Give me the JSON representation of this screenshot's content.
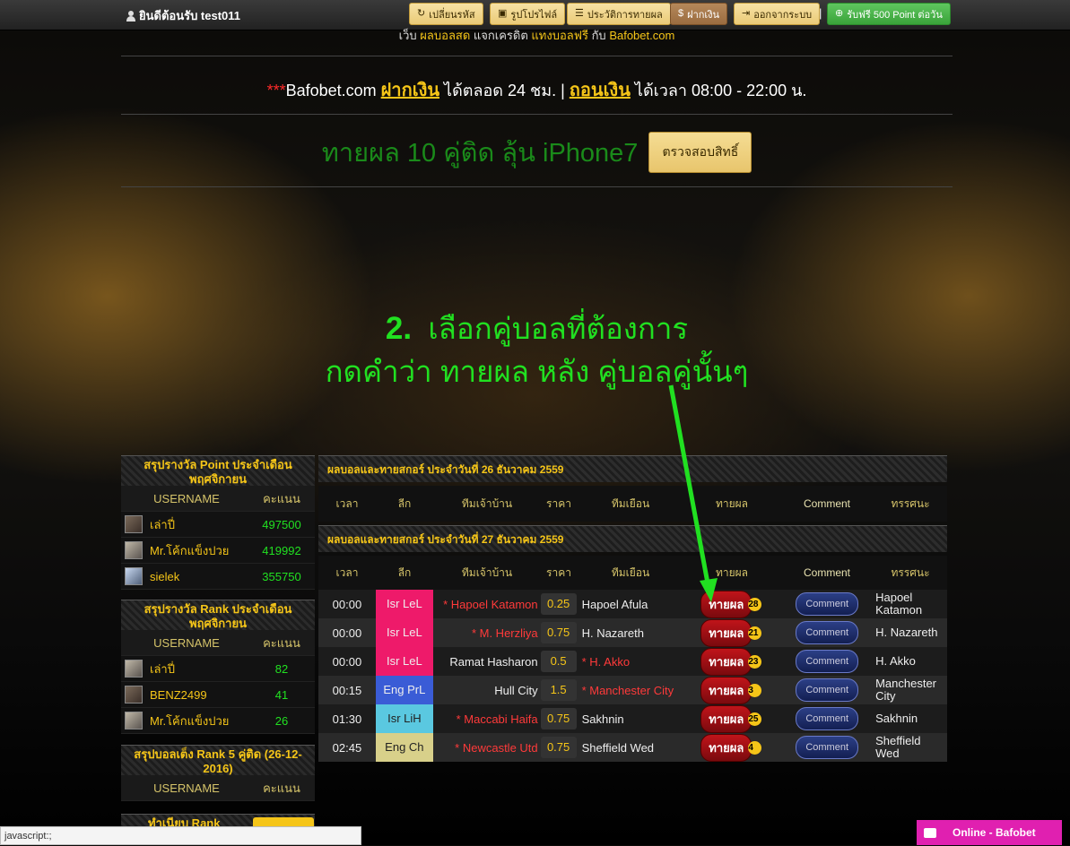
{
  "topbar": {
    "welcome": "ยินดีต้อนรับ test011",
    "buttons": {
      "change_password": "เปลี่ยนรหัส",
      "profile_picture": "รูปโปรไฟล์",
      "guess_history": "ประวัติการทายผล",
      "deposit": "ฝากเงิน",
      "logout": "ออกจากระบบ",
      "free_points": "รับฟรี 500 Point ต่อวัน"
    },
    "separator": "|"
  },
  "banner": {
    "cut_text_1": "เว็บ",
    "cut_link_1": "ผลบอลสด",
    "cut_text_2": "แจกเครดิต",
    "cut_link_2": "แทงบอลฟรี",
    "cut_text_3": "กับ",
    "cut_link_3": "Bafobet.com",
    "stars": "***",
    "site": "Bafobet.com",
    "deposit_link": "ฝากเงิน",
    "deposit_text": "ได้ตลอด 24 ชม. |",
    "withdraw_link": "ถอนเงิน",
    "withdraw_text": "ได้เวลา 08:00 - 22:00 น.",
    "promo_text": "ทายผล 10 คู่ติด ลุ้น iPhone7",
    "promo_button": "ตรวจสอบสิทธิ์"
  },
  "instruction": {
    "step": "2.",
    "line1": "เลือกคู่บอลที่ต้องการ",
    "line2": "กดคำว่า ทายผล หลัง คู่บอลคู่นั้นๆ"
  },
  "sidebar": {
    "point_title": "สรุปรางวัล Point ประจำเดือน พฤศจิกายน",
    "rank_title": "สรุปรางวัล Rank ประจำเดือน พฤศจิกายน",
    "rank5_title": "สรุปบอลเต็ง Rank 5 คู่ติด (26-12-2016)",
    "last_title": "ทำเนียบ Rank",
    "col_user": "USERNAME",
    "col_score": "คะแนน",
    "point_rows": [
      {
        "user": "เล่าปี่",
        "score": "497500"
      },
      {
        "user": "Mr.โค้กแข็งปวย",
        "score": "419992"
      },
      {
        "user": "sielek",
        "score": "355750"
      }
    ],
    "rank_rows": [
      {
        "user": "เล่าปี่",
        "score": "82"
      },
      {
        "user": "BENZ2499",
        "score": "41"
      },
      {
        "user": "Mr.โค้กแข็งปวย",
        "score": "26"
      }
    ]
  },
  "main": {
    "section1_title": "ผลบอลและทายสกอร์ ประจำวันที่ 26 ธันวาคม 2559",
    "section2_title": "ผลบอลและทายสกอร์ ประจำวันที่ 27 ธันวาคม 2559",
    "columns": {
      "time": "เวลา",
      "league": "ลีก",
      "home": "ทีมเจ้าบ้าน",
      "price": "ราคา",
      "away": "ทีมเยือน",
      "guess": "ทายผล",
      "comment": "Comment",
      "view": "ทรรศนะ"
    },
    "guess_label": "ทายผล",
    "comment_label": "Comment",
    "matches": [
      {
        "time": "00:00",
        "league": "Isr LeL",
        "home": "* Hapoel Katamon",
        "price": "0.25",
        "away": "Hapoel Afula",
        "count": "28",
        "view": "Hapoel Katamon"
      },
      {
        "time": "00:00",
        "league": "Isr LeL",
        "home": "* M. Herzliya",
        "price": "0.75",
        "away": "H. Nazareth",
        "count": "21",
        "view": "H. Nazareth"
      },
      {
        "time": "00:00",
        "league": "Isr LeL",
        "home": "Ramat Hasharon",
        "price": "0.5",
        "away": "* H. Akko",
        "count": "23",
        "view": "H. Akko"
      },
      {
        "time": "00:15",
        "league": "Eng PrL",
        "home": "Hull City",
        "price": "1.5",
        "away": "* Manchester City",
        "count": "3",
        "view": "Manchester City"
      },
      {
        "time": "01:30",
        "league": "Isr LiH",
        "home": "* Maccabi Haifa",
        "price": "0.75",
        "away": "Sakhnin",
        "count": "25",
        "view": "Sakhnin"
      },
      {
        "time": "02:45",
        "league": "Eng Ch",
        "home": "* Newcastle Utd",
        "price": "0.75",
        "away": "Sheffield Wed",
        "count": "4",
        "view": "Sheffield Wed"
      }
    ],
    "league_colors": {
      "Isr LeL": "#ee1a6a",
      "Eng PrL": "#3a5cd6",
      "Isr LiH": "#5ac8e0",
      "Eng Ch": "#d8d08a"
    }
  },
  "chat": {
    "label": "Online - Bafobet"
  },
  "statusbar": {
    "url": "javascript:;"
  }
}
